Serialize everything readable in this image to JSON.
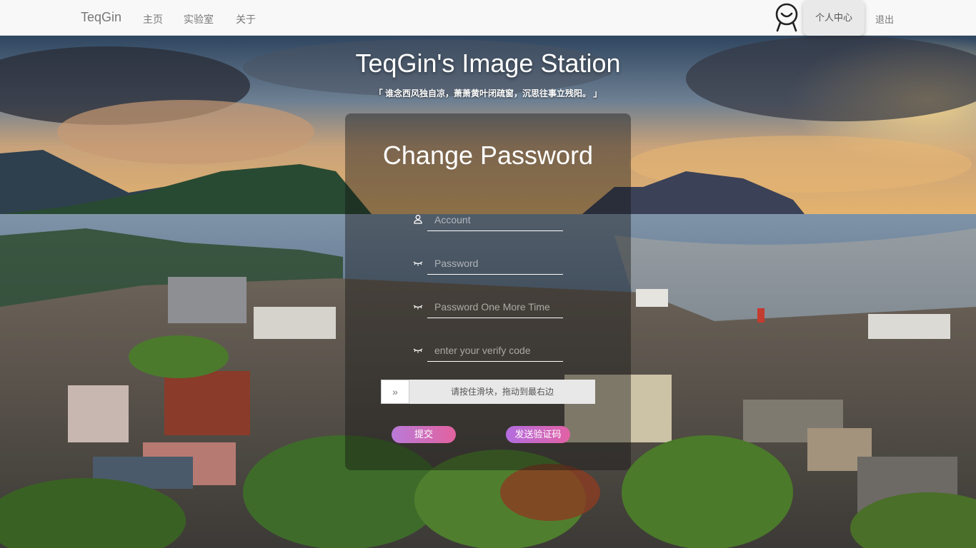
{
  "navbar": {
    "brand": "TeqGin",
    "links": [
      "主页",
      "实验室",
      "关于"
    ],
    "user_center": "个人中心",
    "logout": "退出",
    "avatar_icon": "smiley-avatar-icon"
  },
  "header": {
    "title": "TeqGin's Image Station",
    "quote": "「 谁念西风独自凉，萧萧黄叶闭疏窗，沉思往事立残阳。 」"
  },
  "form": {
    "title": "Change Password",
    "account_placeholder": "Account",
    "password_placeholder": "Password",
    "password_again_placeholder": "Password One More Time",
    "verify_code_placeholder": "enter your verify code",
    "slider_handle": "»",
    "slider_hint": "请按住滑块，拖动到最右边",
    "submit_label": "提交",
    "send_code_label": "发送验证码"
  },
  "icons": {
    "account": "user-icon",
    "password": "eye-icon"
  },
  "colors": {
    "navbar_bg": "#f8f8f8",
    "button_gradient_start": "#b97ad8",
    "button_gradient_end": "#e2629f"
  }
}
